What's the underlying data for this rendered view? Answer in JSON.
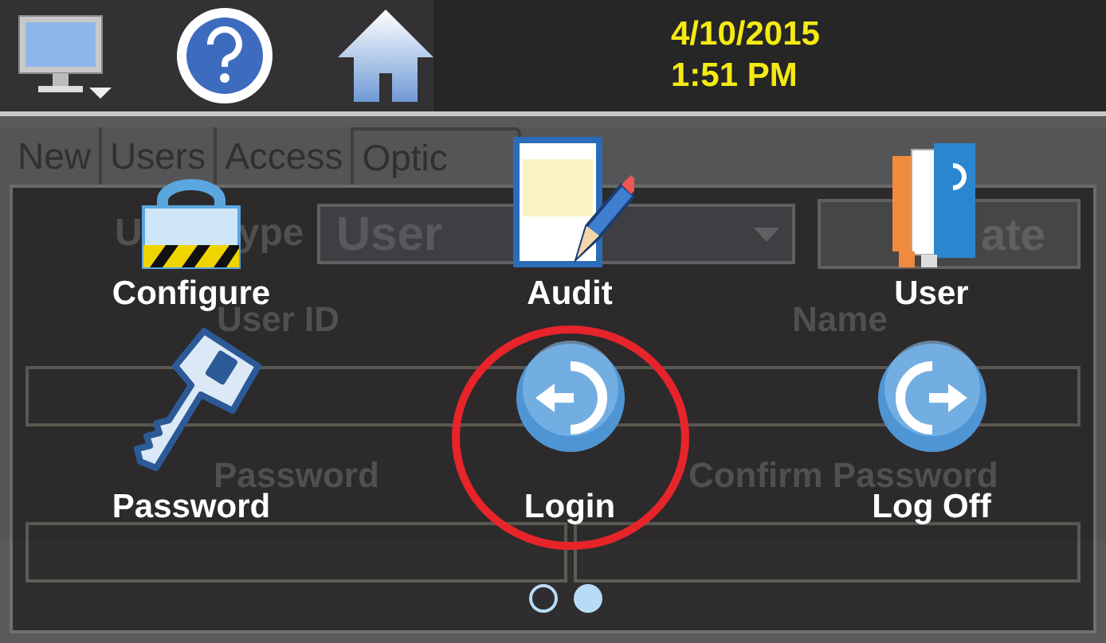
{
  "top_bar": {
    "date": "4/10/2015",
    "time": "1:51 PM"
  },
  "tabs": [
    {
      "label": "New"
    },
    {
      "label": "Users"
    },
    {
      "label": "Access"
    },
    {
      "label": "Optic"
    }
  ],
  "form": {
    "user_type_label": [
      "U",
      "ype"
    ],
    "user_type_value": "User",
    "update_button": "ate",
    "user_id_label": "User ID",
    "name_label": "Name",
    "password_label": "Password",
    "confirm_password_label": "Confirm Password"
  },
  "menu": {
    "items": [
      {
        "kind": "lock",
        "label": "Configure",
        "highlighted": false
      },
      {
        "kind": "notepad",
        "label": "Audit",
        "highlighted": false
      },
      {
        "kind": "books",
        "label": "User",
        "highlighted": false
      },
      {
        "kind": "key",
        "label": "Password",
        "highlighted": false
      },
      {
        "kind": "login",
        "label": "Login",
        "highlighted": true
      },
      {
        "kind": "logoff",
        "label": "Log Off",
        "highlighted": false
      }
    ]
  },
  "pager": {
    "pages": [
      {
        "selected": false
      },
      {
        "selected": true
      }
    ]
  }
}
